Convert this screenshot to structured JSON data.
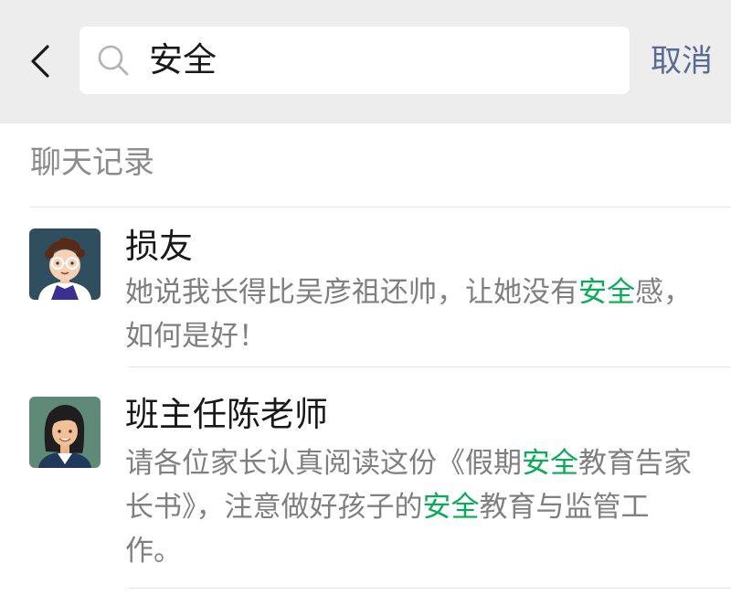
{
  "header": {
    "search_query": "安全",
    "cancel_label": "取消"
  },
  "section": {
    "title": "聊天记录"
  },
  "results": [
    {
      "name": "损友",
      "snippet_parts": [
        "她说我长得比吴彦祖还帅，让她没有",
        "安全",
        "感，如何是好！"
      ]
    },
    {
      "name": "班主任陈老师",
      "snippet_parts": [
        "请各位家长认真阅读这份《假期",
        "安全",
        "教育告家长书》，注意做好孩子的",
        "安全",
        "教育与监管工作。"
      ]
    }
  ],
  "colors": {
    "highlight": "#06ad56",
    "link": "#576b95",
    "header_bg": "#ededed"
  },
  "icons": {
    "back": "chevron-left-icon",
    "search": "search-icon"
  }
}
